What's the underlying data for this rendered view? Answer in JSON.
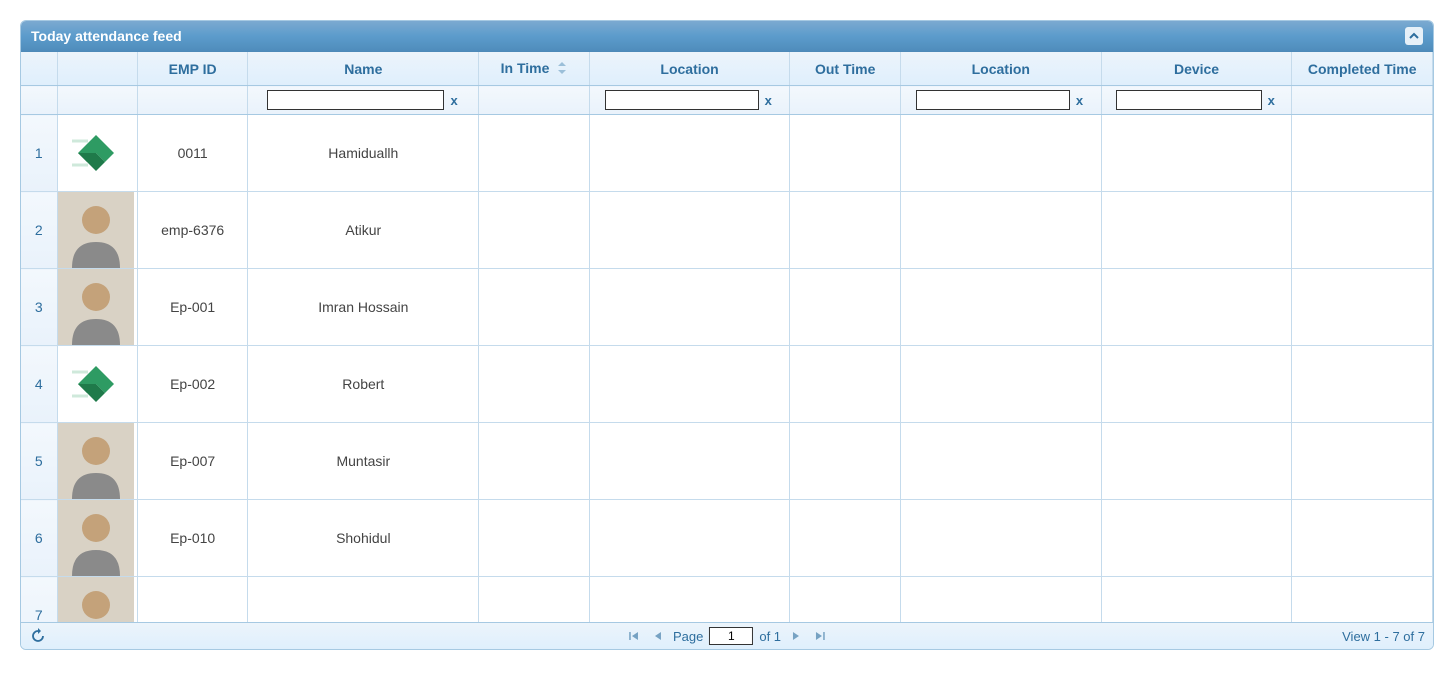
{
  "panel": {
    "title": "Today attendance feed"
  },
  "columns": {
    "emp_id": "EMP ID",
    "name": "Name",
    "in_time": "In Time",
    "location1": "Location",
    "out_time": "Out Time",
    "location2": "Location",
    "device": "Device",
    "completed_time": "Completed Time"
  },
  "filter": {
    "clear_label": "x",
    "name_value": "",
    "location1_value": "",
    "location2_value": "",
    "device_value": ""
  },
  "rows": [
    {
      "num": "1",
      "emp_id": "0011",
      "name": "Hamiduallh",
      "in_time": "",
      "location1": "",
      "out_time": "",
      "location2": "",
      "device": "",
      "completed_time": "",
      "avatar": "logo"
    },
    {
      "num": "2",
      "emp_id": "emp-6376",
      "name": "Atikur",
      "in_time": "",
      "location1": "",
      "out_time": "",
      "location2": "",
      "device": "",
      "completed_time": "",
      "avatar": "person"
    },
    {
      "num": "3",
      "emp_id": "Ep-001",
      "name": "Imran Hossain",
      "in_time": "",
      "location1": "",
      "out_time": "",
      "location2": "",
      "device": "",
      "completed_time": "",
      "avatar": "person"
    },
    {
      "num": "4",
      "emp_id": "Ep-002",
      "name": "Robert",
      "in_time": "",
      "location1": "",
      "out_time": "",
      "location2": "",
      "device": "",
      "completed_time": "",
      "avatar": "logo"
    },
    {
      "num": "5",
      "emp_id": "Ep-007",
      "name": "Muntasir",
      "in_time": "",
      "location1": "",
      "out_time": "",
      "location2": "",
      "device": "",
      "completed_time": "",
      "avatar": "person"
    },
    {
      "num": "6",
      "emp_id": "Ep-010",
      "name": "Shohidul",
      "in_time": "",
      "location1": "",
      "out_time": "",
      "location2": "",
      "device": "",
      "completed_time": "",
      "avatar": "person"
    },
    {
      "num": "7",
      "emp_id": "",
      "name": "",
      "in_time": "",
      "location1": "",
      "out_time": "",
      "location2": "",
      "device": "",
      "completed_time": "",
      "avatar": "person"
    }
  ],
  "pager": {
    "page_label": "Page",
    "page_value": "1",
    "of_label": "of 1",
    "view_label": "View 1 - 7 of 7"
  }
}
